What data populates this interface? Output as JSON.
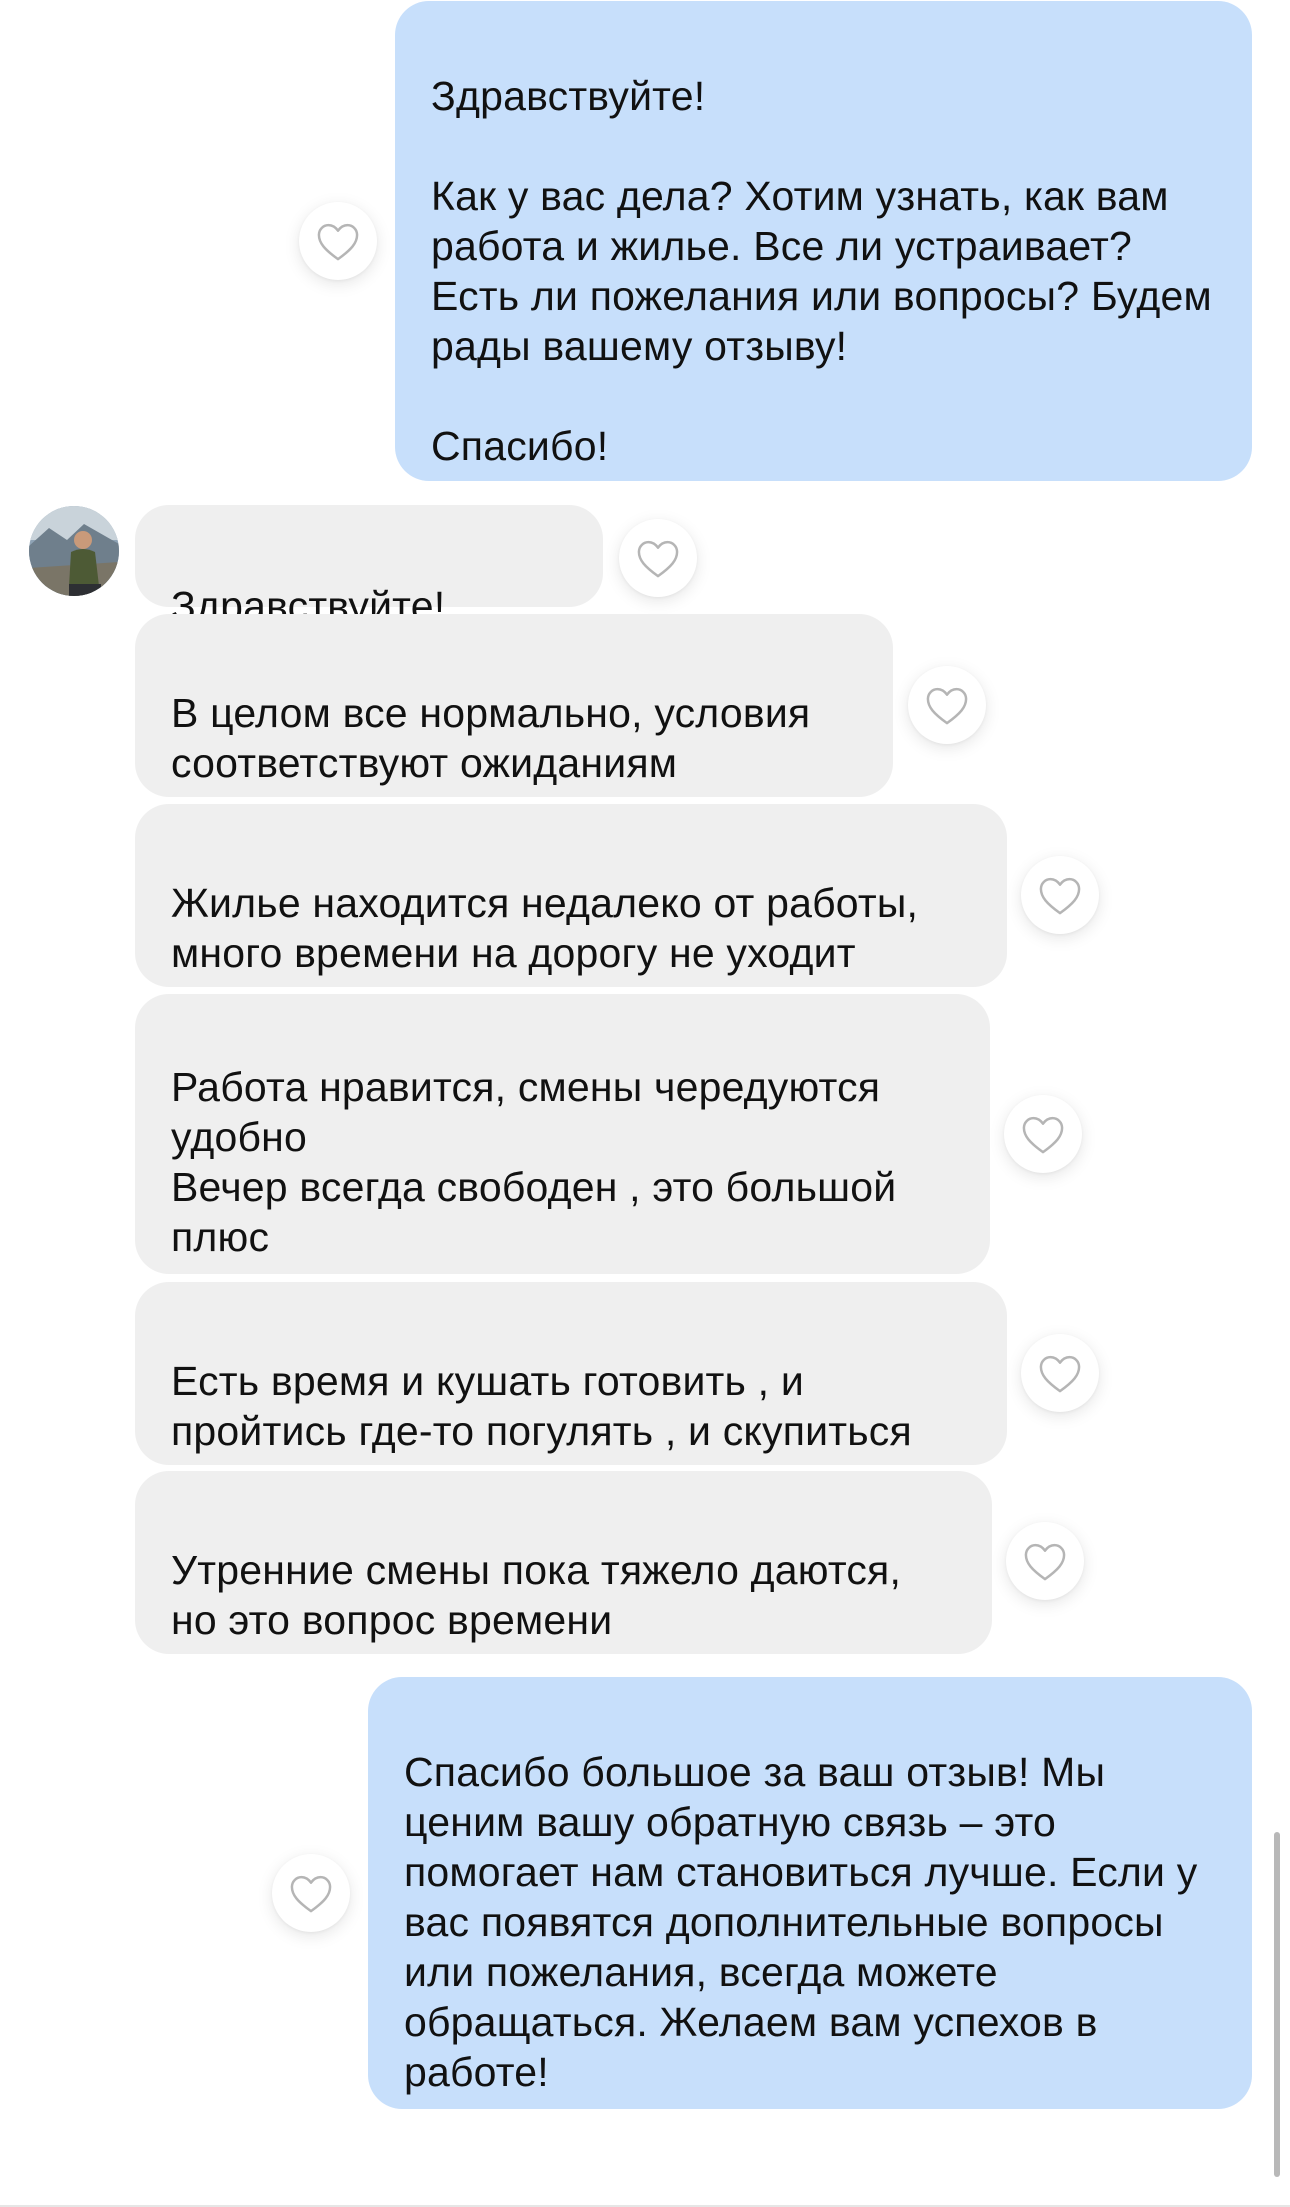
{
  "chat": {
    "messages": [
      {
        "direction": "outgoing",
        "text": "Здравствуйте!\n\nКак у вас дела? Хотим узнать, как вам работа и жилье. Все ли устраивает? Есть ли пожелания или вопросы? Будем рады вашему отзыву!\n\nСпасибо!"
      },
      {
        "direction": "incoming",
        "text": "Здравствуйте!"
      },
      {
        "direction": "incoming",
        "text": "В целом все нормально, условия соответствуют ожиданиям"
      },
      {
        "direction": "incoming",
        "text": "Жилье находится недалеко от работы, много времени на дорогу не уходит"
      },
      {
        "direction": "incoming",
        "text": "Работа нравится, смены чередуются удобно\nВечер всегда свободен , это большой плюс"
      },
      {
        "direction": "incoming",
        "text": "Есть время и кушать готовить , и пройтись где-то погулять , и скупиться"
      },
      {
        "direction": "incoming",
        "text": "Утренние смены пока тяжело даются, но это вопрос времени"
      },
      {
        "direction": "outgoing",
        "text": "Спасибо большое за ваш отзыв! Мы ценим вашу обратную связь – это помогает нам становиться лучше. Если у вас появятся дополнительные вопросы или пожелания, всегда можете обращаться. Желаем вам успехов в работе!"
      }
    ],
    "icons": {
      "reaction": "heart-outline-icon",
      "avatar": "user-avatar"
    },
    "colors": {
      "outgoing_bubble": "#c7dffb",
      "incoming_bubble": "#efefef",
      "heart_stroke": "#b5b5b5"
    }
  }
}
